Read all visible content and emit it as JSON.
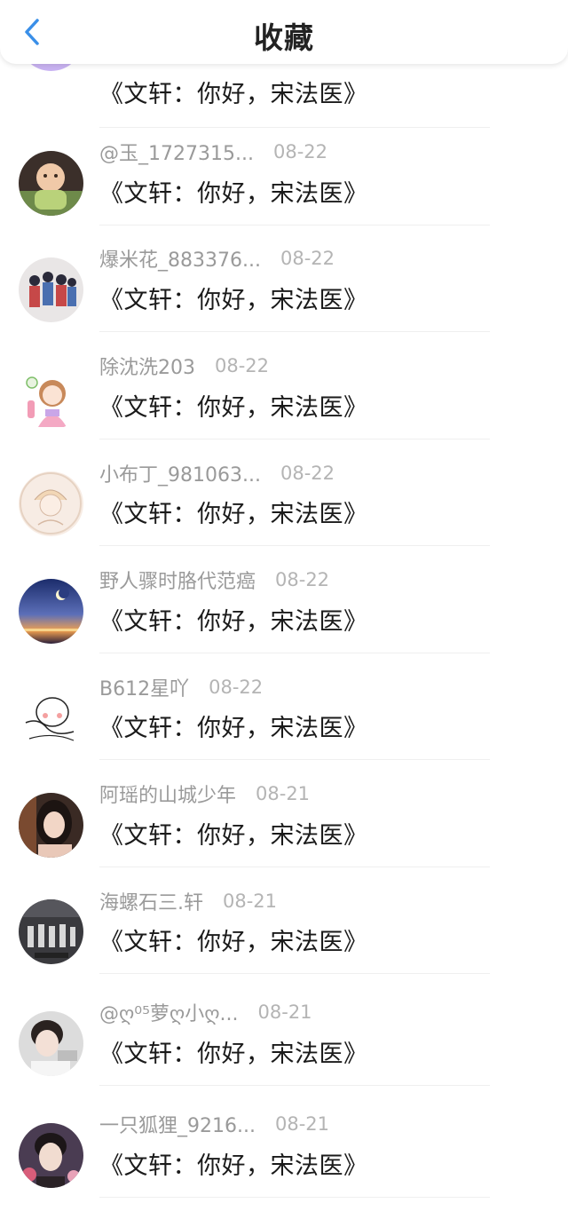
{
  "header": {
    "title": "收藏",
    "back_icon": "chevron-left-icon",
    "accent": "#3a8fe8"
  },
  "items": [
    {
      "name": "",
      "date": "",
      "content": "《文轩：你好，宋法医》",
      "avatar": "purple-chat"
    },
    {
      "name": "@玉_1727315...",
      "date": "08-22",
      "content": "《文轩：你好，宋法医》",
      "avatar": "baby"
    },
    {
      "name": "爆米花_883376...",
      "date": "08-22",
      "content": "《文轩：你好，宋法医》",
      "avatar": "group"
    },
    {
      "name": "除沈洗203",
      "date": "08-22",
      "content": "《文轩：你好，宋法医》",
      "avatar": "cartoon-girl"
    },
    {
      "name": "小布丁_981063...",
      "date": "08-22",
      "content": "《文轩：你好，宋法医》",
      "avatar": "sketch-girl"
    },
    {
      "name": "野人骤时胳代范癌",
      "date": "08-22",
      "content": "《文轩：你好，宋法医》",
      "avatar": "night-sky"
    },
    {
      "name": "B612星吖",
      "date": "08-22",
      "content": "《文轩：你好，宋法医》",
      "avatar": "line-drawing"
    },
    {
      "name": "阿瑶的山城少年",
      "date": "08-21",
      "content": "《文轩：你好，宋法医》",
      "avatar": "girl-photo"
    },
    {
      "name": "海螺石三.轩",
      "date": "08-21",
      "content": "《文轩：你好，宋法医》",
      "avatar": "dance-group"
    },
    {
      "name": "@ღ⁰⁵萝ღ小ღ...",
      "date": "08-21",
      "content": "《文轩：你好，宋法医》",
      "avatar": "boy-photo"
    },
    {
      "name": "一只狐狸_9216...",
      "date": "08-21",
      "content": "《文轩：你好，宋法医》",
      "avatar": "boy-portrait"
    }
  ]
}
